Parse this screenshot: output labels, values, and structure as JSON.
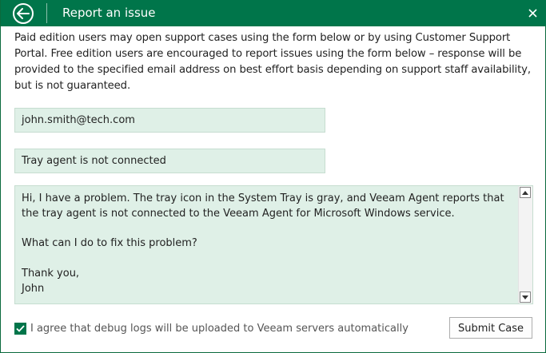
{
  "window": {
    "title": "Report an issue",
    "accent_color": "#00754a",
    "field_background": "#dff0e7"
  },
  "titlebar": {
    "back_icon": "back-arrow-circle-icon",
    "close_icon": "close-icon"
  },
  "intro": {
    "text": "Paid edition users may open support cases using the form below or by using Customer Support Portal. Free edition users are encouraged to report issues using the form below – response will be provided to the specified email address on best effort basis depending on support staff availability, but is not guaranteed."
  },
  "form": {
    "email_value": "john.smith@tech.com",
    "subject_value": "Tray agent is not connected",
    "message_value": "Hi, I have a problem. The tray icon in the System Tray is gray, and Veeam Agent reports that the tray agent is not connected to the Veeam Agent for Microsoft Windows service.\n\nWhat can I do to fix this problem?\n\nThank you,\nJohn",
    "agree_checked": true,
    "agree_label": "I agree that debug logs will be uploaded to Veeam servers automatically"
  },
  "actions": {
    "submit_label": "Submit Case"
  }
}
